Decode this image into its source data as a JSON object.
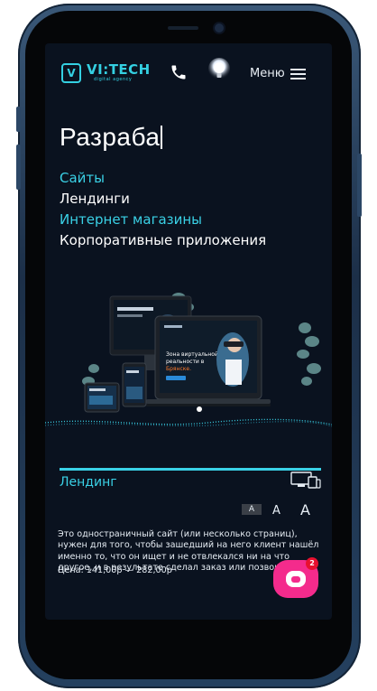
{
  "header": {
    "logo_mark": "V",
    "logo_text": "VI:TECH",
    "logo_sub": "digital agency",
    "menu_label": "Меню",
    "icons": {
      "phone": "phone-icon",
      "bulb": "lightbulb-icon",
      "burger": "hamburger-menu-icon"
    }
  },
  "hero": {
    "typing_text": "Разраба",
    "services": [
      "Сайты",
      "Лендинги",
      "Интернет магазины",
      "Корпоративные приложения"
    ],
    "mockup_headline": "Зона виртуальной реальности в Брянске."
  },
  "section": {
    "title": "Лендинг",
    "font_size_options": [
      "A",
      "A",
      "A"
    ],
    "description": "Это одностраничный сайт (или несколько страниц), нужен для того, чтобы зашедший на него клиент нашёл именно то, что он ищет и не отвлекался ни на что другое, и в результате сделал заказ или позвонил.",
    "price": "Цена: 141,00р — 282,00р"
  },
  "chat": {
    "badge_count": "2"
  },
  "colors": {
    "accent": "#3ad1e6",
    "screen_bg": "#0a121f",
    "chat": "#f42b8c"
  }
}
